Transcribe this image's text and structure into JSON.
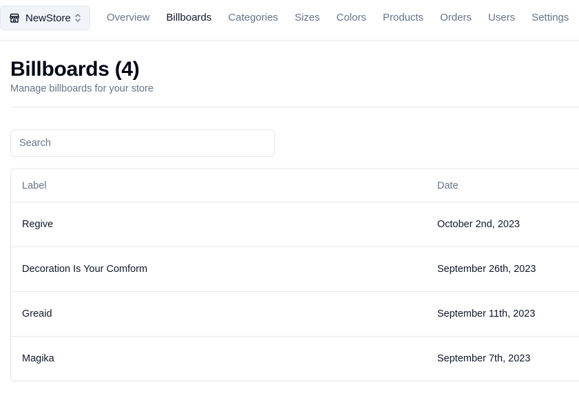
{
  "store_switcher": {
    "name": "NewStore",
    "icon": "store-icon"
  },
  "nav": {
    "items": [
      {
        "label": "Overview",
        "active": false
      },
      {
        "label": "Billboards",
        "active": true
      },
      {
        "label": "Categories",
        "active": false
      },
      {
        "label": "Sizes",
        "active": false
      },
      {
        "label": "Colors",
        "active": false
      },
      {
        "label": "Products",
        "active": false
      },
      {
        "label": "Orders",
        "active": false
      },
      {
        "label": "Users",
        "active": false
      },
      {
        "label": "Settings",
        "active": false
      }
    ]
  },
  "page": {
    "title": "Billboards (4)",
    "subtitle": "Manage billboards for your store"
  },
  "search": {
    "placeholder": "Search",
    "value": ""
  },
  "table": {
    "columns": [
      "Label",
      "Date"
    ],
    "rows": [
      {
        "label": "Regive",
        "date": "October 2nd, 2023"
      },
      {
        "label": "Decoration Is Your Comform",
        "date": "September 26th, 2023"
      },
      {
        "label": "Greaid",
        "date": "September 11th, 2023"
      },
      {
        "label": "Magika",
        "date": "September 7th, 2023"
      }
    ]
  }
}
